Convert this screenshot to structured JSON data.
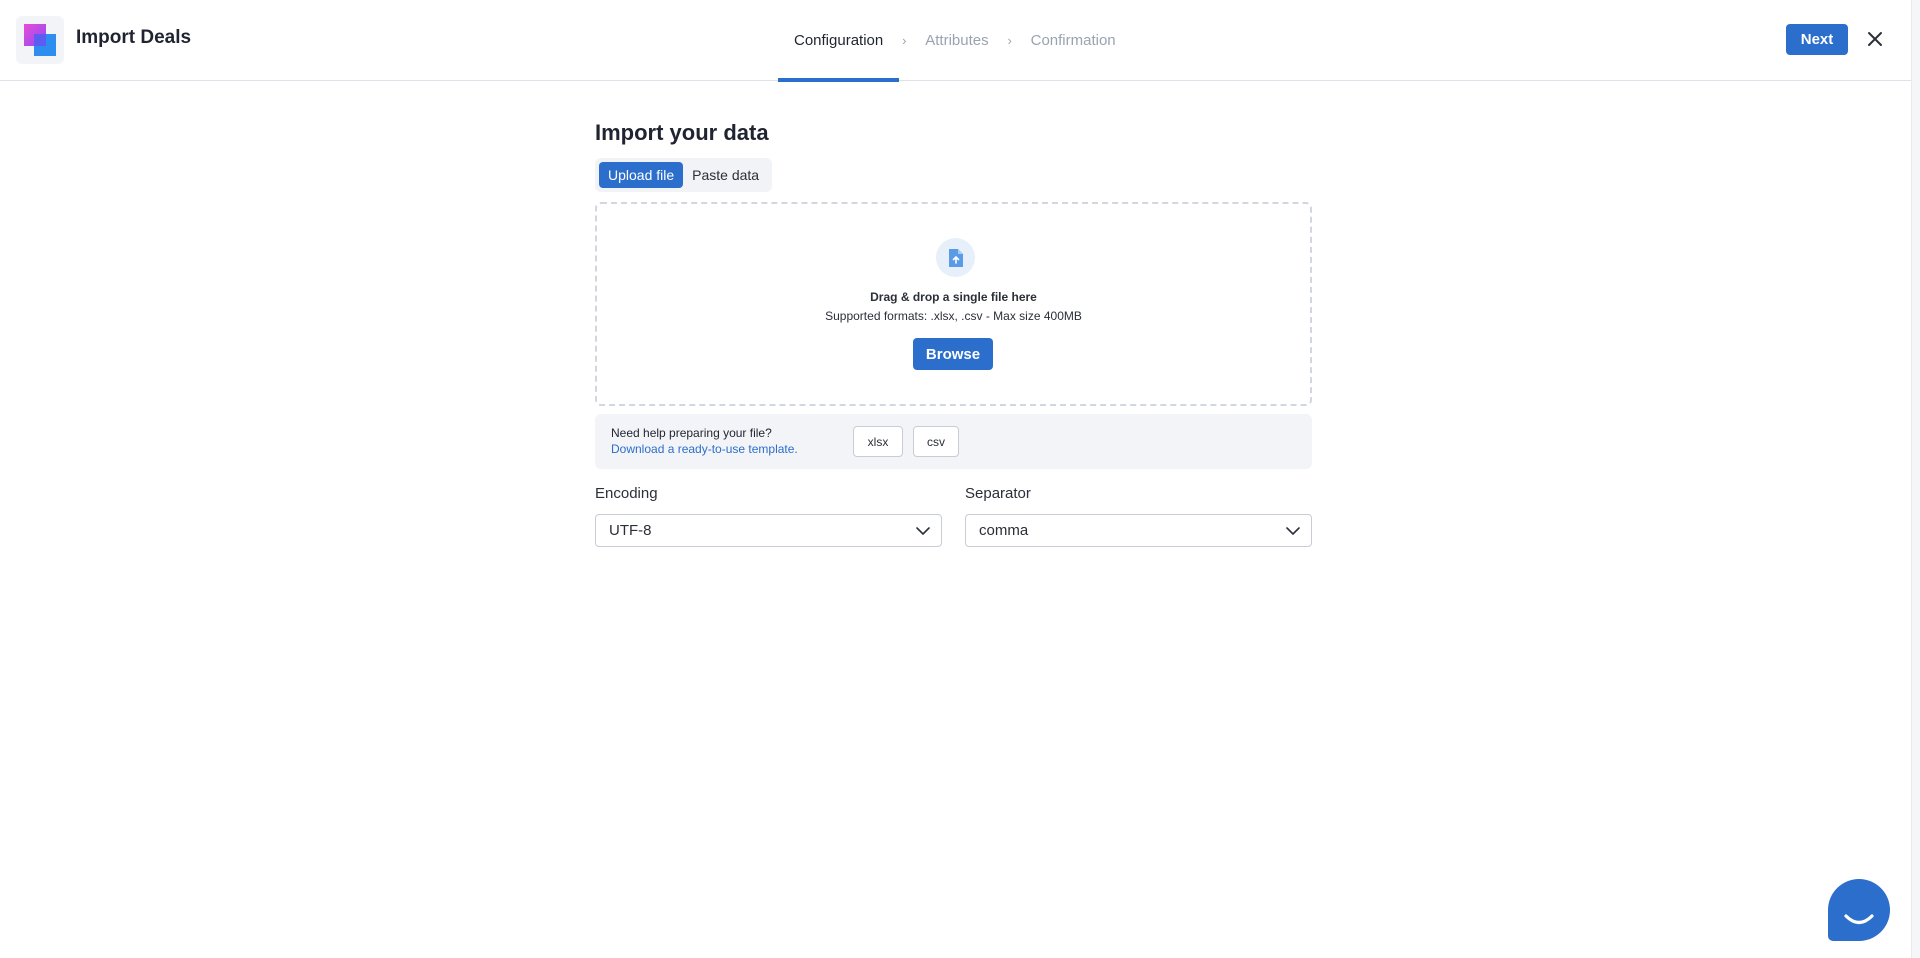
{
  "header": {
    "app_title": "Import Deals",
    "steps": [
      {
        "label": "Configuration",
        "active": true
      },
      {
        "label": "Attributes",
        "active": false
      },
      {
        "label": "Confirmation",
        "active": false
      }
    ],
    "next_label": "Next"
  },
  "main": {
    "title": "Import your data",
    "tabs": [
      {
        "label": "Upload file",
        "active": true
      },
      {
        "label": "Paste data",
        "active": false
      }
    ],
    "dropzone": {
      "title": "Drag & drop a single file here",
      "subtitle": "Supported formats: .xlsx, .csv - Max size 400MB",
      "browse_label": "Browse"
    },
    "help": {
      "title": "Need help preparing your file?",
      "link": "Download a ready-to-use template.",
      "formats": [
        "xlsx",
        "csv"
      ]
    },
    "encoding": {
      "label": "Encoding",
      "value": "UTF-8"
    },
    "separator": {
      "label": "Separator",
      "value": "comma"
    }
  },
  "colors": {
    "accent": "#2c6ecb",
    "text": "#2b2f38",
    "muted": "#9aa3b2",
    "border": "#c8ccd5"
  },
  "icons": [
    "app-logo",
    "chevron-right-icon",
    "close-icon",
    "file-upload-icon",
    "chevron-down-icon",
    "chat-icon"
  ]
}
